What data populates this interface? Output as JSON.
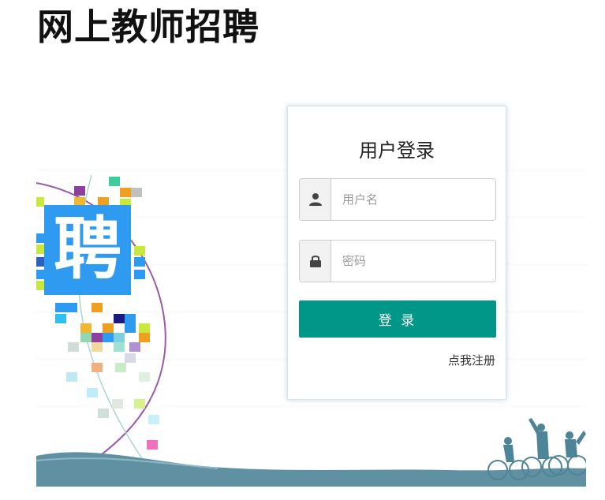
{
  "header": {
    "title": "网上教师招聘"
  },
  "hero": {
    "badge_text": "聘"
  },
  "login": {
    "title": "用户登录",
    "username_placeholder": "用户名",
    "password_placeholder": "密码",
    "submit_label": "登 录",
    "register_label": "点我注册"
  },
  "icons": {
    "username": "user-icon",
    "password": "lock-icon"
  },
  "colors": {
    "primary": "#009688",
    "hero_blue": "#2e9bf0",
    "ground": "#5f91a2"
  }
}
